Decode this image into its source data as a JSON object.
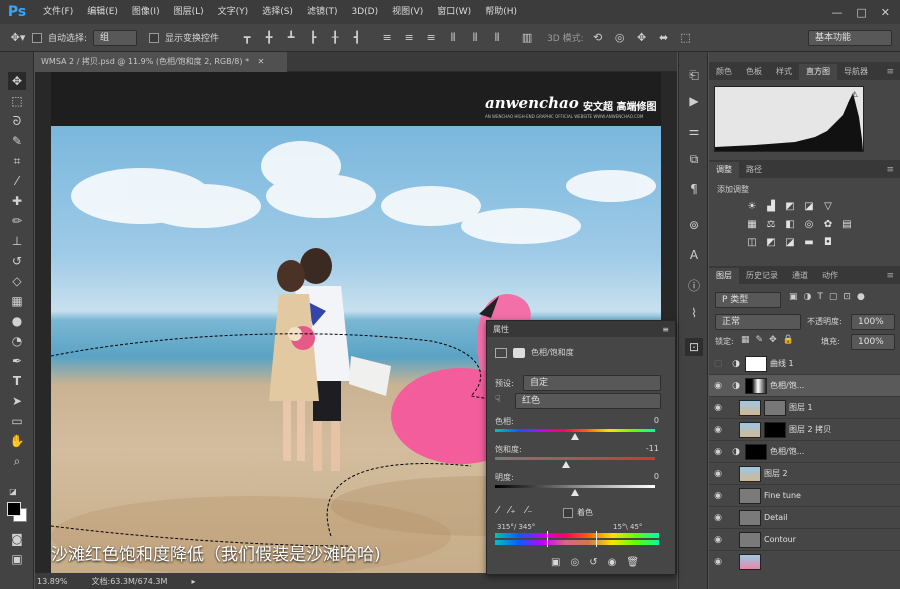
{
  "app": {
    "logo": "Ps"
  },
  "menu": [
    "文件(F)",
    "编辑(E)",
    "图像(I)",
    "图层(L)",
    "文字(Y)",
    "选择(S)",
    "滤镜(T)",
    "3D(D)",
    "视图(V)",
    "窗口(W)",
    "帮助(H)"
  ],
  "options": {
    "auto_select_label": "自动选择:",
    "auto_select_value": "组",
    "show_transform_label": "显示变换控件",
    "mode_3d_label": "3D 模式:",
    "workspace": "基本功能"
  },
  "document": {
    "tab_title": "WMSA 2 / 拷贝.psd @ 11.9% (色相/饱和度 2, RGB/8) *",
    "zoom": "13.89%",
    "doc_info": "文档:63.3M/674.3M"
  },
  "watermark": {
    "brand": "anwenchao",
    "cn": "安文超 高端修图",
    "sub": "AN WENCHAO HIGH-END GRAPHIC OFFICIAL WEBSITE  WWW.ANWENCHAO.COM"
  },
  "caption": "沙滩红色饱和度降低（我们假装是沙滩哈哈)",
  "panels": {
    "top_tabs": [
      "颜色",
      "色板",
      "样式",
      "直方图",
      "导航器"
    ],
    "adj_tabs": [
      "调整",
      "路径"
    ],
    "adj_title": "添加调整",
    "layer_tabs": [
      "图层",
      "历史记录",
      "通道",
      "动作"
    ],
    "layer_kind": "P 类型",
    "blend_mode": "正常",
    "opacity_label": "不透明度:",
    "opacity_value": "100%",
    "lock_label": "锁定:",
    "fill_label": "填充:",
    "fill_value": "100%"
  },
  "layers": [
    {
      "name": "曲线 1",
      "visible": false
    },
    {
      "name": "色相/饱...",
      "visible": true,
      "selected": true
    },
    {
      "name": "图层 1",
      "visible": true
    },
    {
      "name": "图层 2 拷贝",
      "visible": true
    },
    {
      "name": "色相/饱...",
      "visible": true
    },
    {
      "name": "图层 2",
      "visible": true
    },
    {
      "name": "Fine tune",
      "visible": true
    },
    {
      "name": "Detail",
      "visible": true
    },
    {
      "name": "Contour",
      "visible": true
    }
  ],
  "properties": {
    "tab": "属性",
    "title": "色相/饱和度",
    "preset_label": "预设:",
    "preset_value": "自定",
    "channel_value": "红色",
    "hue_label": "色相:",
    "hue_value": "0",
    "sat_label": "饱和度:",
    "sat_value": "-11",
    "light_label": "明度:",
    "light_value": "0",
    "colorize_label": "着色",
    "range_left": "315°/ 345°",
    "range_right": "15°\\ 45°"
  },
  "colors": {
    "accent": "#31a8ff",
    "panel": "#464646",
    "menubar": "#3c3c3c"
  }
}
